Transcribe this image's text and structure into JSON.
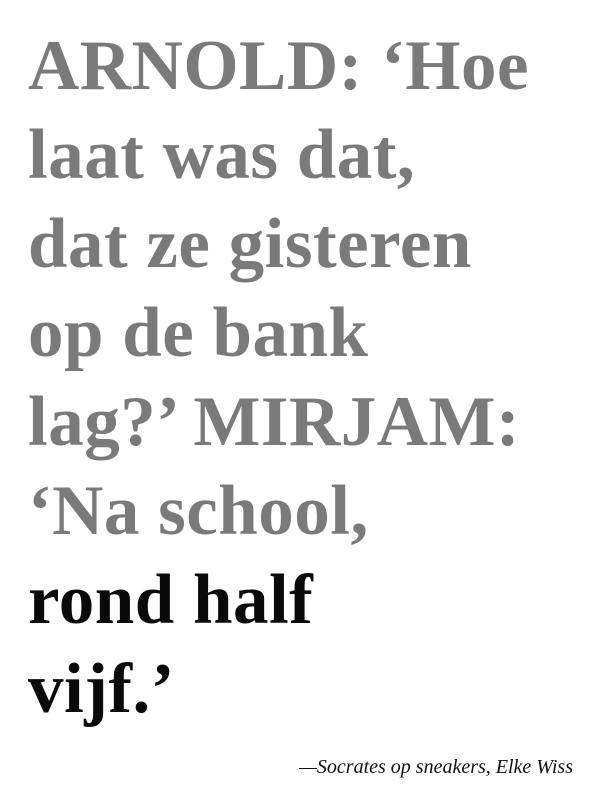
{
  "quote": {
    "lines": [
      "ARNOLD: ‘Hoe",
      "laat was dat,",
      "dat ze gisteren",
      "op de bank",
      "lag?’ MIRJAM:",
      "‘Na school,",
      "rond half",
      "vijf.’"
    ],
    "colors": {
      "muted": "#7a7a7a",
      "emphasis": "#0a0a0a"
    }
  },
  "attribution": "—Socrates op sneakers, Elke Wiss"
}
